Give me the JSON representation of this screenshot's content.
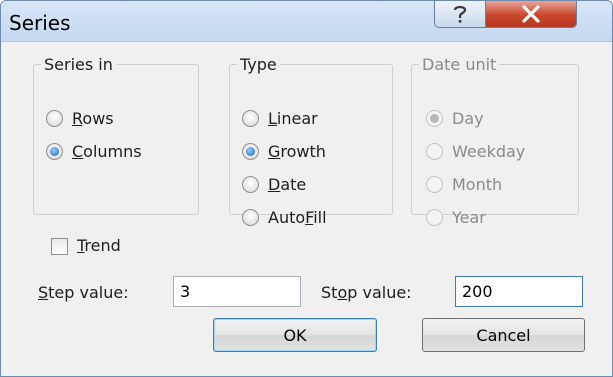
{
  "window": {
    "title": "Series"
  },
  "title_buttons": {
    "help_icon": "question-mark-icon",
    "close_icon": "close-x-icon"
  },
  "series_in": {
    "legend": "Series in",
    "options": [
      {
        "label_before": "",
        "accel": "R",
        "label_after": "ows",
        "checked": false
      },
      {
        "label_before": "",
        "accel": "C",
        "label_after": "olumns",
        "checked": true
      }
    ]
  },
  "type": {
    "legend": "Type",
    "options": [
      {
        "label_before": "",
        "accel": "L",
        "label_after": "inear",
        "checked": false
      },
      {
        "label_before": "",
        "accel": "G",
        "label_after": "rowth",
        "checked": true
      },
      {
        "label_before": "",
        "accel": "D",
        "label_after": "ate",
        "checked": false
      },
      {
        "label_before": "Auto",
        "accel": "F",
        "label_after": "ill",
        "checked": false
      }
    ]
  },
  "date_unit": {
    "legend": "Date unit",
    "enabled": false,
    "options": [
      {
        "label": "Day",
        "checked": true
      },
      {
        "label": "Weekday",
        "checked": false
      },
      {
        "label": "Month",
        "checked": false
      },
      {
        "label": "Year",
        "checked": false
      }
    ]
  },
  "trend": {
    "accel": "T",
    "label_after": "rend",
    "checked": false
  },
  "step": {
    "accel": "S",
    "label_after": "tep value:",
    "value": "3"
  },
  "stop": {
    "label_before": "St",
    "accel": "o",
    "label_after": "p value:",
    "value": "200"
  },
  "buttons": {
    "ok": "OK",
    "cancel": "Cancel"
  },
  "colors": {
    "close_red": "#c8462b",
    "title_bar": "#c4d8f0",
    "dialog_bg": "#f0f0f0"
  }
}
